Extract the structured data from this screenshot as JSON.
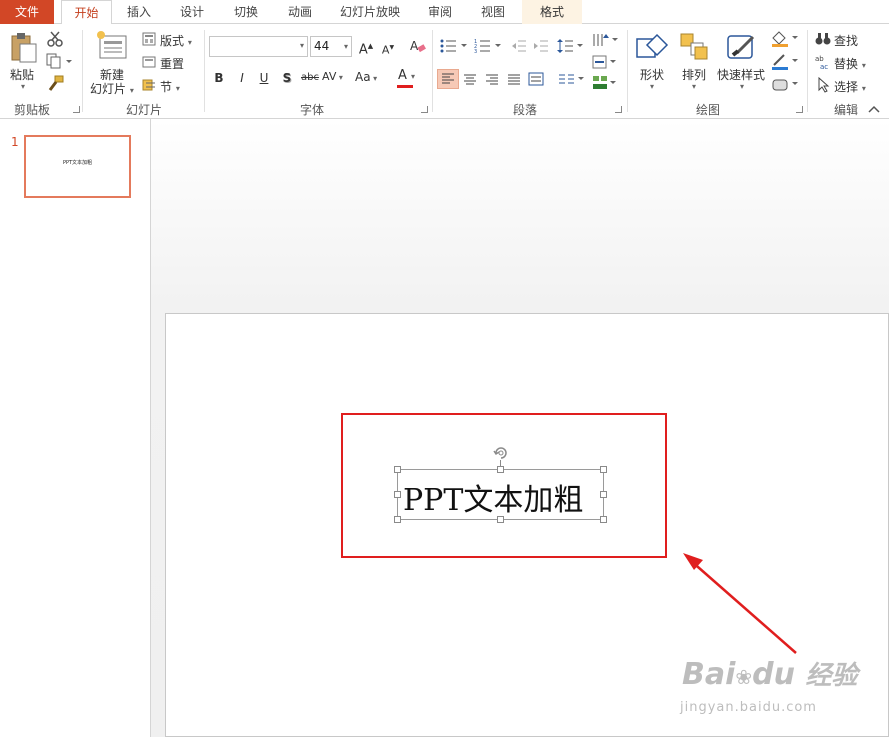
{
  "tabs": {
    "file": "文件",
    "home": "开始",
    "insert": "插入",
    "design": "设计",
    "transitions": "切换",
    "animations": "动画",
    "slideshow": "幻灯片放映",
    "review": "审阅",
    "view": "视图",
    "format": "格式"
  },
  "clipboard": {
    "paste": "粘贴",
    "group": "剪贴板"
  },
  "slides": {
    "new_line1": "新建",
    "new_line2": "幻灯片",
    "layout": "版式",
    "reset": "重置",
    "section": "节",
    "group": "幻灯片"
  },
  "font": {
    "name": "",
    "size": "44",
    "group": "字体",
    "bold": "B",
    "italic": "I",
    "underline": "U",
    "shadow": "S",
    "strike": "abc",
    "spacing": "AV",
    "case": "Aa",
    "color_letter": "A",
    "grow": "A",
    "shrink": "A"
  },
  "paragraph": {
    "group": "段落"
  },
  "drawing": {
    "shapes": "形状",
    "arrange": "排列",
    "quick_styles": "快速样式",
    "group": "绘图"
  },
  "editing": {
    "find": "查找",
    "replace": "替换",
    "select": "选择",
    "group": "编辑"
  },
  "thumbnails": [
    {
      "number": "1",
      "text": "PPT文本加粗"
    }
  ],
  "slide_textbox": {
    "text": "PPT文本加粗"
  },
  "watermark": {
    "brand": "Bai",
    "brand2": "du",
    "product": "经验",
    "url": "jingyan.baidu.com"
  },
  "colors": {
    "file_tab": "#d24726",
    "active_tab_text": "#c43e1c",
    "highlight_box": "#e01e1e",
    "thumb_border": "#e47a5c",
    "font_color_bar": "#e01e1e"
  }
}
